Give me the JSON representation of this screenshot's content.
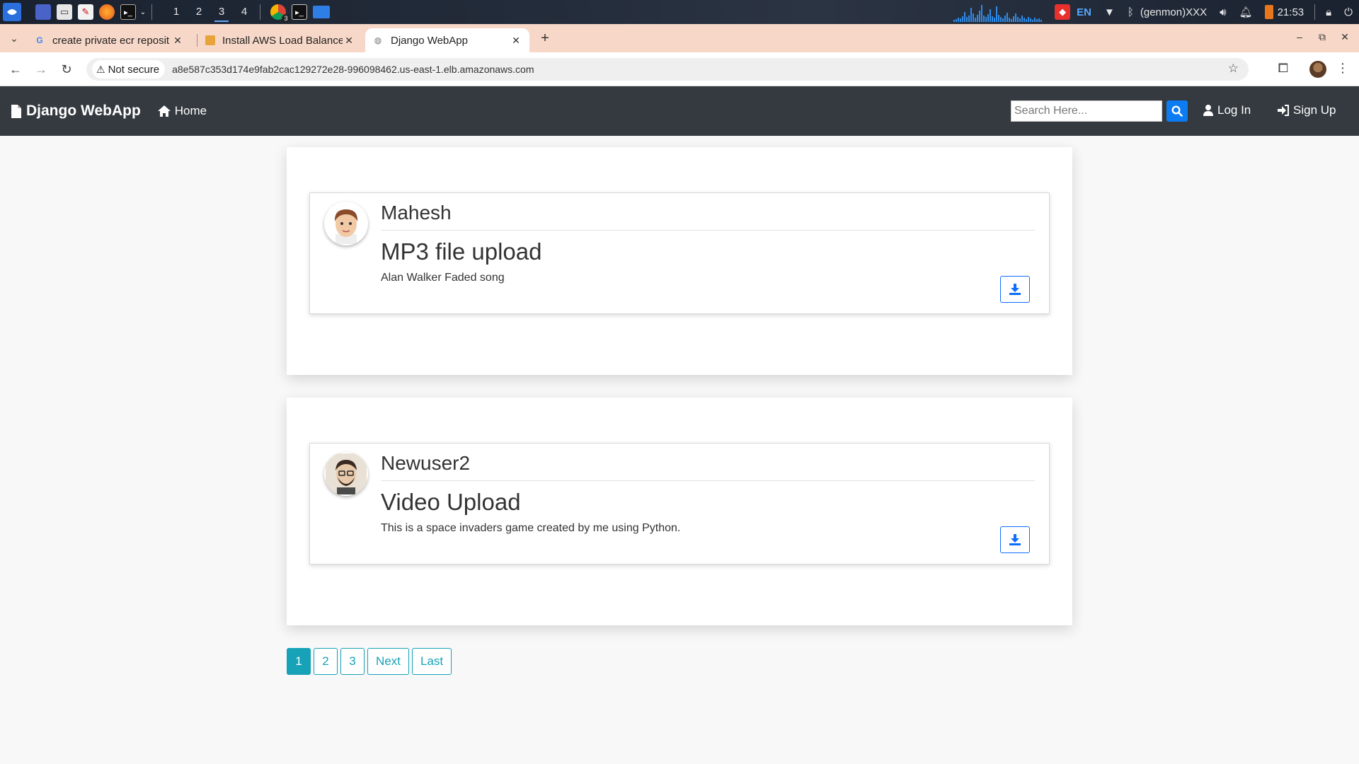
{
  "taskbar": {
    "workspaces": [
      "1",
      "2",
      "3",
      "4"
    ],
    "active_workspace": "3",
    "chrome_badge": "3",
    "lang": "EN",
    "genmon": "(genmon)XXX",
    "time": "21:53"
  },
  "browser": {
    "tabs": [
      {
        "title": "create private ecr reposit",
        "favicon": "google-icon"
      },
      {
        "title": "Install AWS Load Balance",
        "favicon": "aws-docs-icon"
      },
      {
        "title": "Django WebApp",
        "favicon": "globe-icon"
      }
    ],
    "security_label": "Not secure",
    "url": "a8e587c353d174e9fab2cac129272e28-996098462.us-east-1.elb.amazonaws.com"
  },
  "site": {
    "brand": "Django WebApp",
    "home_label": "Home",
    "search_placeholder": "Search Here...",
    "login_label": "Log In",
    "signup_label": "Sign Up",
    "nav_color": "#343a40",
    "accent": "#0d7cf2"
  },
  "posts": [
    {
      "author": "Mahesh",
      "title": "MP3 file upload",
      "description": "Alan Walker Faded song"
    },
    {
      "author": "Newuser2",
      "title": "Video Upload",
      "description": "This is a space invaders game created by me using Python."
    }
  ],
  "pagination": {
    "pages": [
      "1",
      "2",
      "3"
    ],
    "current": "1",
    "next_label": "Next",
    "last_label": "Last",
    "color": "#17a2b8"
  }
}
